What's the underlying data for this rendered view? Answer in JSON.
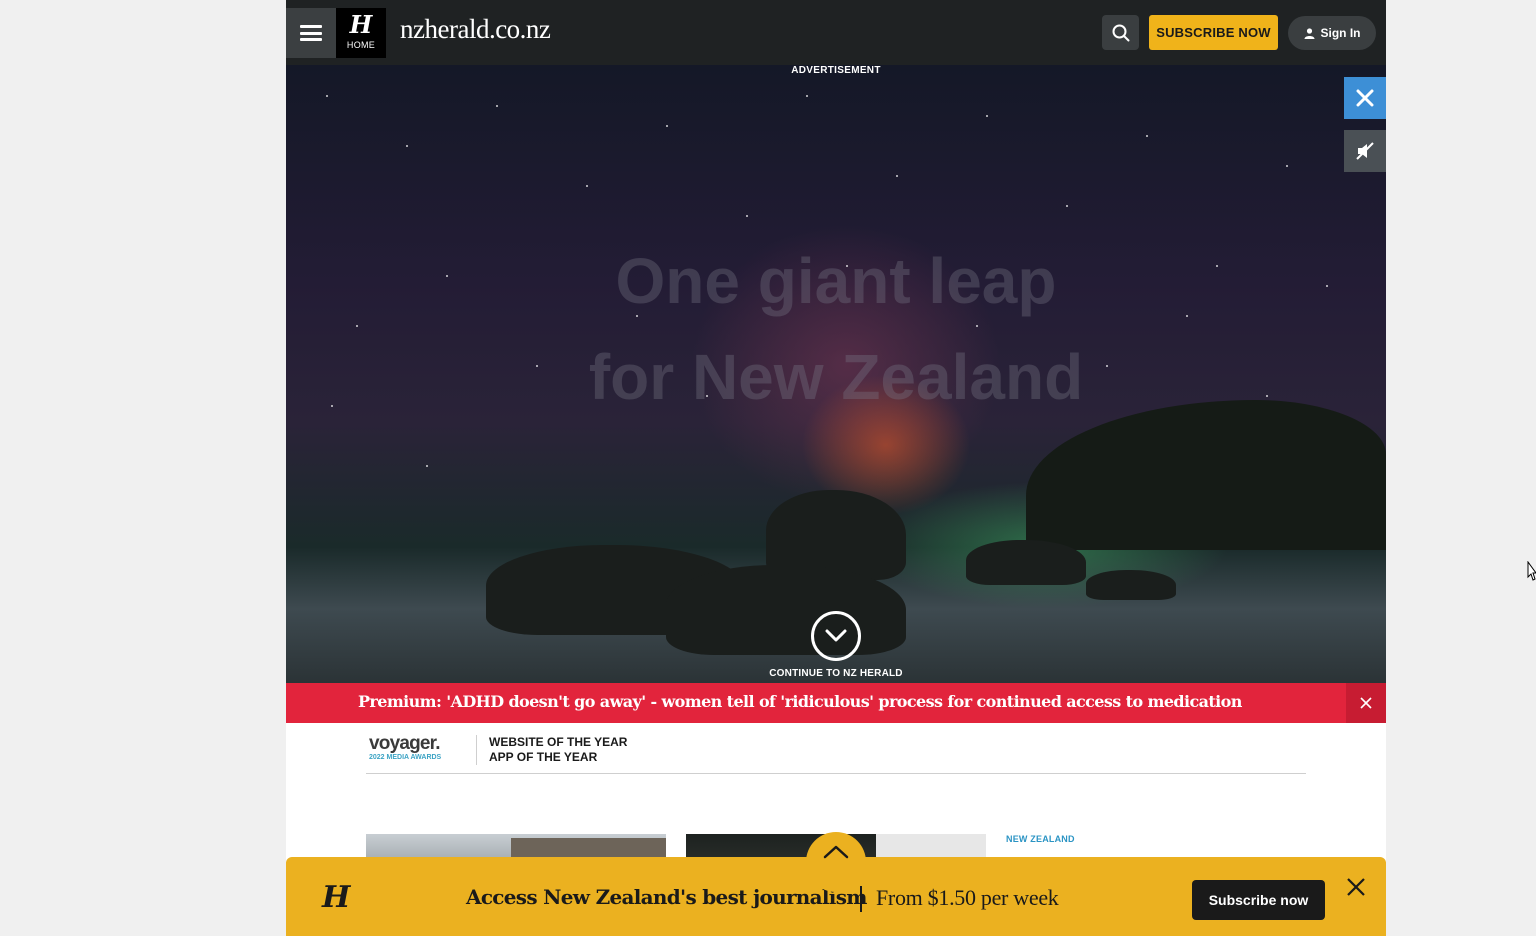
{
  "header": {
    "menu_icon": "hamburger-menu-icon",
    "logo_letter": "H",
    "home_label": "HOME",
    "site_name": "nzherald.co.nz",
    "search_icon": "search-icon",
    "subscribe_label": "SUBSCRIBE NOW",
    "signin_label": "Sign In",
    "signin_icon": "person-icon"
  },
  "ad": {
    "label": "ADVERTISEMENT",
    "headline_line1": "One giant leap",
    "headline_line2": "for New Zealand",
    "close_icon": "close-icon",
    "mute_icon": "speaker-muted-icon",
    "continue_label": "CONTINUE TO NZ HERALD",
    "continue_icon": "chevron-down-circle-icon"
  },
  "breaking": {
    "text": "Premium: 'ADHD doesn't go away' - women tell of 'ridiculous' process for continued access to medication",
    "close_icon": "close-icon"
  },
  "awards": {
    "brand": "voyager.",
    "brand_sub": "2022 MEDIA AWARDS",
    "line1": "WEBSITE OF THE YEAR",
    "line2": "APP OF THE YEAR"
  },
  "articles": {
    "section_tag": "NEW ZEALAND"
  },
  "subscribe_banner": {
    "logo_letter": "H",
    "headline": "Access New Zealand's best journalism",
    "price": "From $1.50 per week",
    "button_label": "Subscribe now",
    "close_icon": "close-icon",
    "scroll_icon": "chevron-up-icon"
  },
  "colors": {
    "header_bg": "#1f2223",
    "subscribe_yellow": "#f0b31a",
    "breaking_red": "#e2243c",
    "ad_close_blue": "#3d8fd6",
    "banner_yellow": "#ebb120",
    "section_blue": "#2b94c4"
  }
}
